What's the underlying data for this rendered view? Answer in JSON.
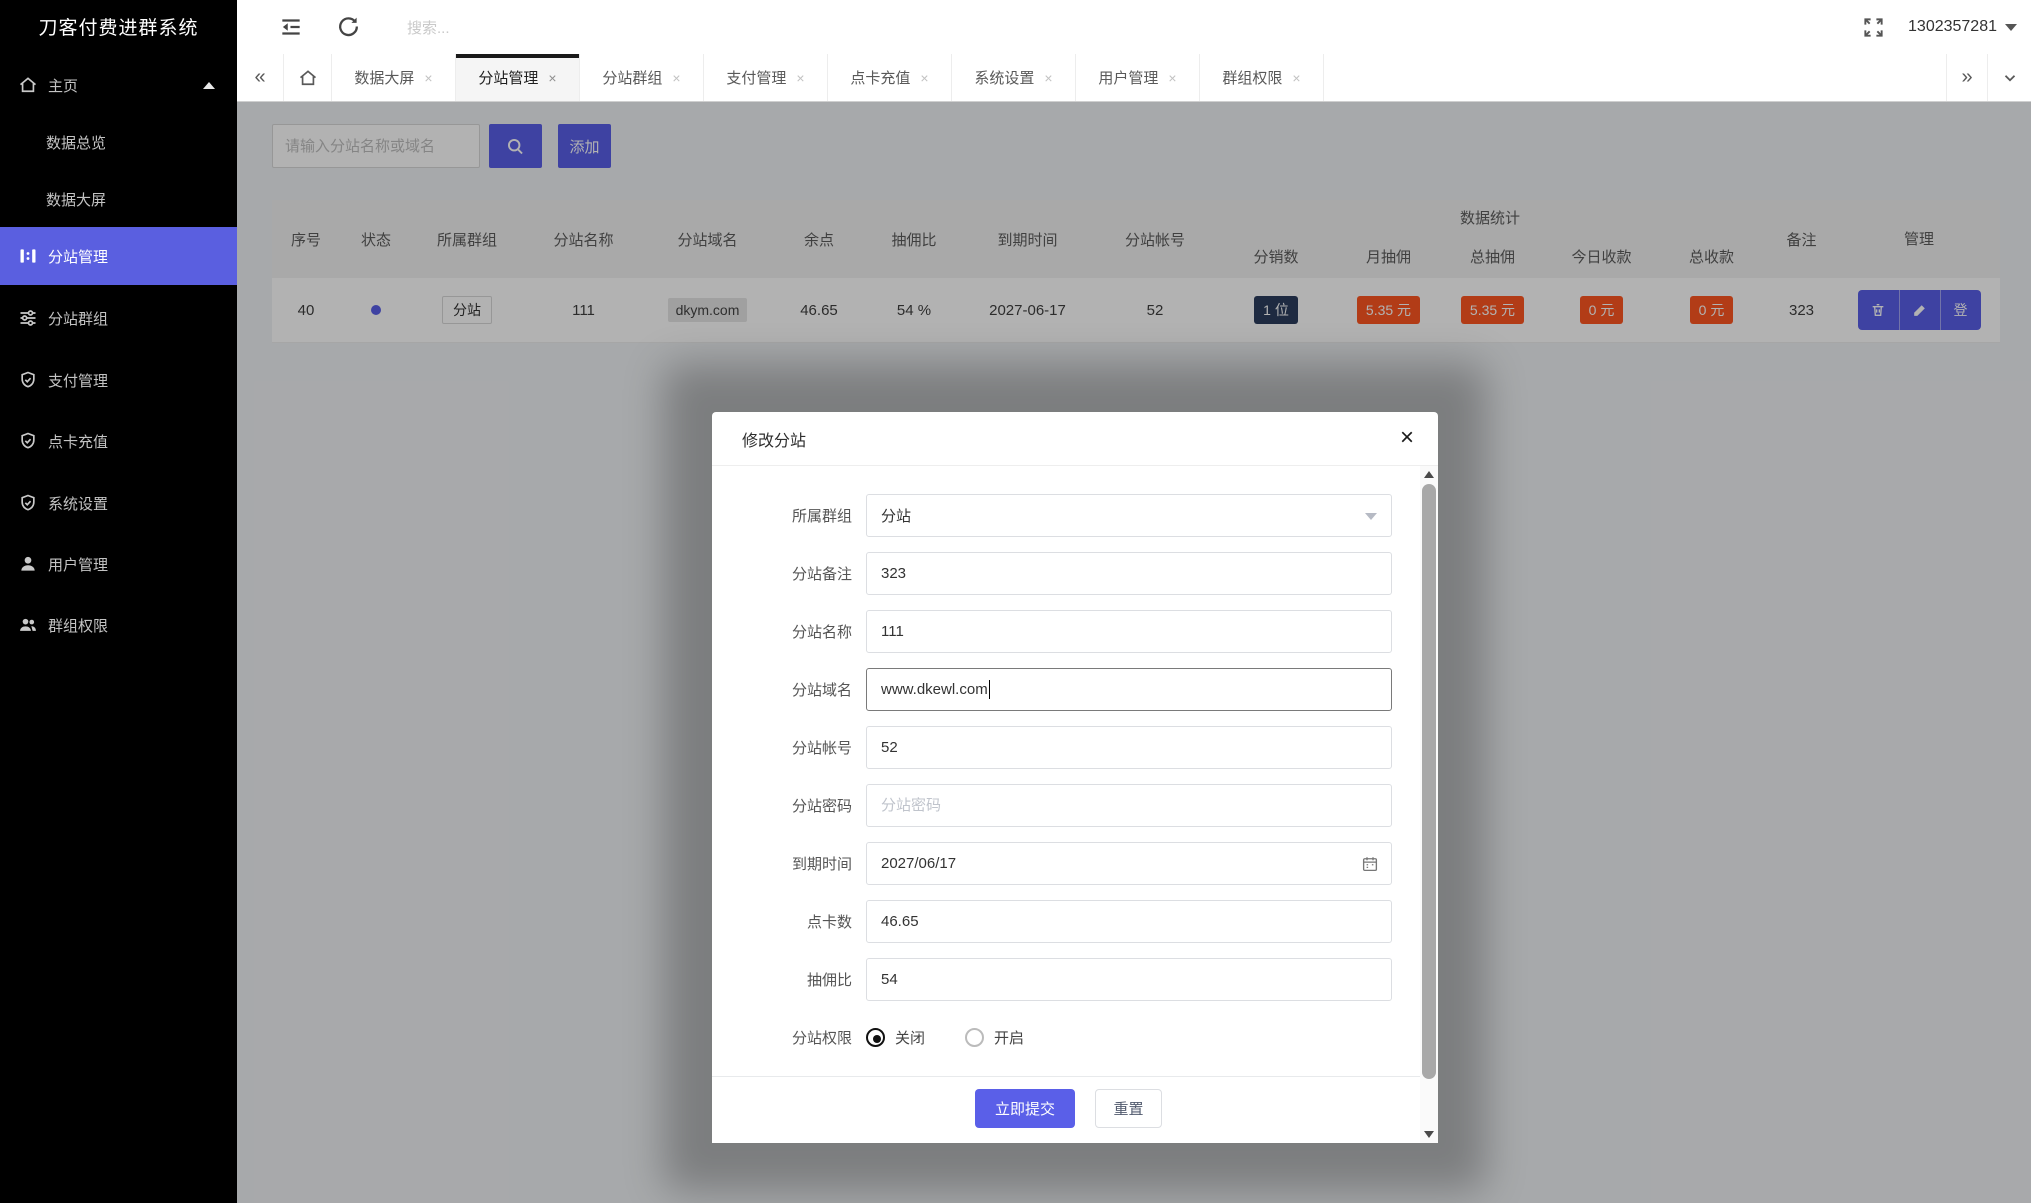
{
  "app": {
    "title": "刀客付费进群系统",
    "user_id": "1302357281"
  },
  "topbar": {
    "search_placeholder": "搜索..."
  },
  "sidebar": {
    "home": {
      "label": "主页"
    },
    "items": [
      {
        "label": "数据总览"
      },
      {
        "label": "数据大屏"
      },
      {
        "label": "分站管理"
      },
      {
        "label": "分站群组"
      },
      {
        "label": "支付管理"
      },
      {
        "label": "点卡充值"
      },
      {
        "label": "系统设置"
      },
      {
        "label": "用户管理"
      },
      {
        "label": "群组权限"
      }
    ]
  },
  "tabs": [
    "数据大屏",
    "分站管理",
    "分站群组",
    "支付管理",
    "点卡充值",
    "系统设置",
    "用户管理",
    "群组权限"
  ],
  "toolbar": {
    "search_placeholder": "请输入分站名称或域名",
    "add_label": "添加"
  },
  "table": {
    "group_header": "数据统计",
    "headers": [
      "序号",
      "状态",
      "所属群组",
      "分站名称",
      "分站域名",
      "余点",
      "抽佣比",
      "到期时间",
      "分站帐号"
    ],
    "group_cols": [
      "分销数",
      "月抽佣",
      "总抽佣",
      "今日收款",
      "总收款"
    ],
    "tail_headers": [
      "备注",
      "管理"
    ],
    "row": {
      "index": "40",
      "group_tag": "分站",
      "name": "111",
      "domain": "dkym.com",
      "balance": "46.65",
      "commission_rate": "54 %",
      "expire_date": "2027-06-17",
      "account": "52",
      "distributors": "1 位",
      "month_commission": "5.35 元",
      "total_commission": "5.35 元",
      "today_income": "0 元",
      "total_income": "0 元",
      "remark": "323",
      "login_label": "登"
    }
  },
  "modal": {
    "title": "修改分站",
    "fields": [
      {
        "label": "所属群组",
        "value": "分站"
      },
      {
        "label": "分站备注",
        "value": "323"
      },
      {
        "label": "分站名称",
        "value": "111"
      },
      {
        "label": "分站域名",
        "value": "www.dkewl.com"
      },
      {
        "label": "分站帐号",
        "value": "52"
      },
      {
        "label": "分站密码",
        "placeholder": "分站密码"
      },
      {
        "label": "到期时间",
        "value": "2027/06/17"
      },
      {
        "label": "点卡数",
        "value": "46.65"
      },
      {
        "label": "抽佣比",
        "value": "54"
      },
      {
        "label": "分站权限",
        "options": [
          {
            "label": "关闭"
          },
          {
            "label": "开启"
          }
        ]
      }
    ],
    "submit_label": "立即提交",
    "reset_label": "重置"
  },
  "colors": {
    "accent": "#5a5fe8",
    "sidebar_active": "#5a5fe0",
    "badge_red": "#ff5722",
    "badge_dark": "#2b3d5e",
    "sidebar_bg": "#000000"
  }
}
